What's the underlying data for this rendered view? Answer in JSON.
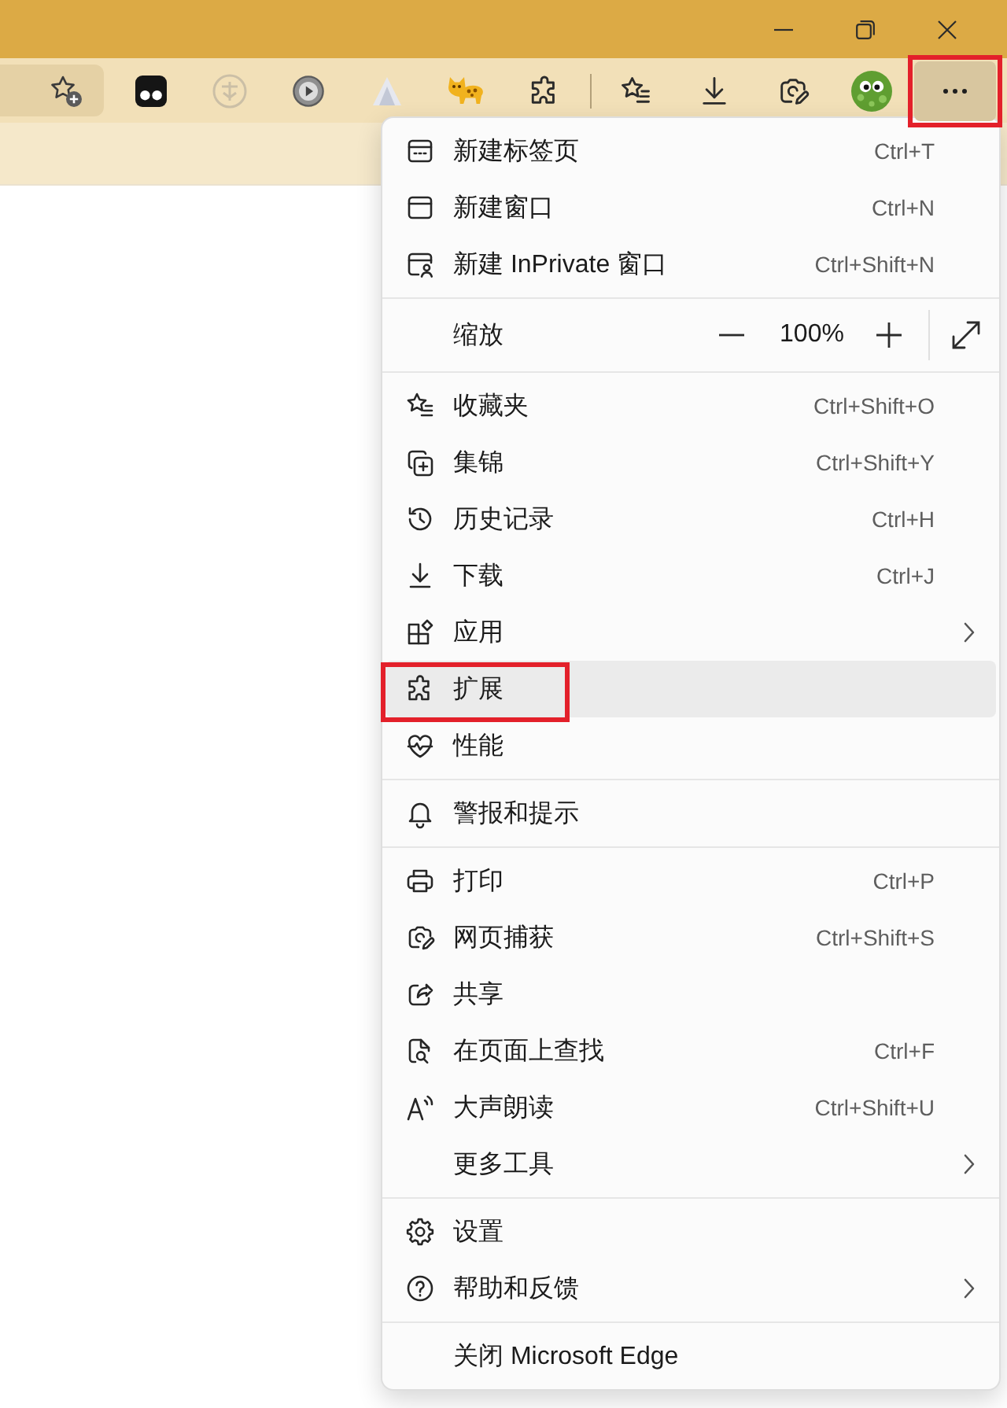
{
  "toolbar": {
    "more_button": {
      "highlighted": true
    }
  },
  "menu": {
    "sections": [
      {
        "items": [
          {
            "kind": "command",
            "label": "新建标签页",
            "shortcut": "Ctrl+T",
            "hovered": false,
            "highlighted": false
          },
          {
            "kind": "command",
            "label": "新建窗口",
            "shortcut": "Ctrl+N",
            "hovered": false,
            "highlighted": false
          },
          {
            "kind": "command",
            "label": "新建 InPrivate 窗口",
            "shortcut": "Ctrl+Shift+N",
            "hovered": false,
            "highlighted": false
          }
        ]
      },
      {
        "items": [
          {
            "kind": "zoom",
            "label": "缩放",
            "value": "100%",
            "hovered": false,
            "highlighted": false
          }
        ]
      },
      {
        "items": [
          {
            "kind": "command",
            "label": "收藏夹",
            "shortcut": "Ctrl+Shift+O",
            "hovered": false,
            "highlighted": false
          },
          {
            "kind": "command",
            "label": "集锦",
            "shortcut": "Ctrl+Shift+Y",
            "hovered": false,
            "highlighted": false
          },
          {
            "kind": "command",
            "label": "历史记录",
            "shortcut": "Ctrl+H",
            "hovered": false,
            "highlighted": false
          },
          {
            "kind": "command",
            "label": "下载",
            "shortcut": "Ctrl+J",
            "hovered": false,
            "highlighted": false
          },
          {
            "kind": "submenu",
            "label": "应用",
            "hovered": false,
            "highlighted": false
          },
          {
            "kind": "command",
            "label": "扩展",
            "hovered": true,
            "highlighted": true
          },
          {
            "kind": "command",
            "label": "性能",
            "hovered": false,
            "highlighted": false
          }
        ]
      },
      {
        "items": [
          {
            "kind": "command",
            "label": "警报和提示",
            "hovered": false,
            "highlighted": false
          }
        ]
      },
      {
        "items": [
          {
            "kind": "command",
            "label": "打印",
            "shortcut": "Ctrl+P",
            "hovered": false,
            "highlighted": false
          },
          {
            "kind": "command",
            "label": "网页捕获",
            "shortcut": "Ctrl+Shift+S",
            "hovered": false,
            "highlighted": false
          },
          {
            "kind": "command",
            "label": "共享",
            "hovered": false,
            "highlighted": false
          },
          {
            "kind": "command",
            "label": "在页面上查找",
            "shortcut": "Ctrl+F",
            "hovered": false,
            "highlighted": false
          },
          {
            "kind": "command",
            "label": "大声朗读",
            "shortcut": "Ctrl+Shift+U",
            "hovered": false,
            "highlighted": false
          },
          {
            "kind": "submenu",
            "label": "更多工具",
            "hovered": false,
            "highlighted": false
          }
        ]
      },
      {
        "items": [
          {
            "kind": "command",
            "label": "设置",
            "hovered": false,
            "highlighted": false
          },
          {
            "kind": "submenu",
            "label": "帮助和反馈",
            "hovered": false,
            "highlighted": false
          }
        ]
      },
      {
        "items": [
          {
            "kind": "command",
            "label": "关闭 Microsoft Edge",
            "hovered": false,
            "highlighted": false
          }
        ]
      }
    ]
  }
}
